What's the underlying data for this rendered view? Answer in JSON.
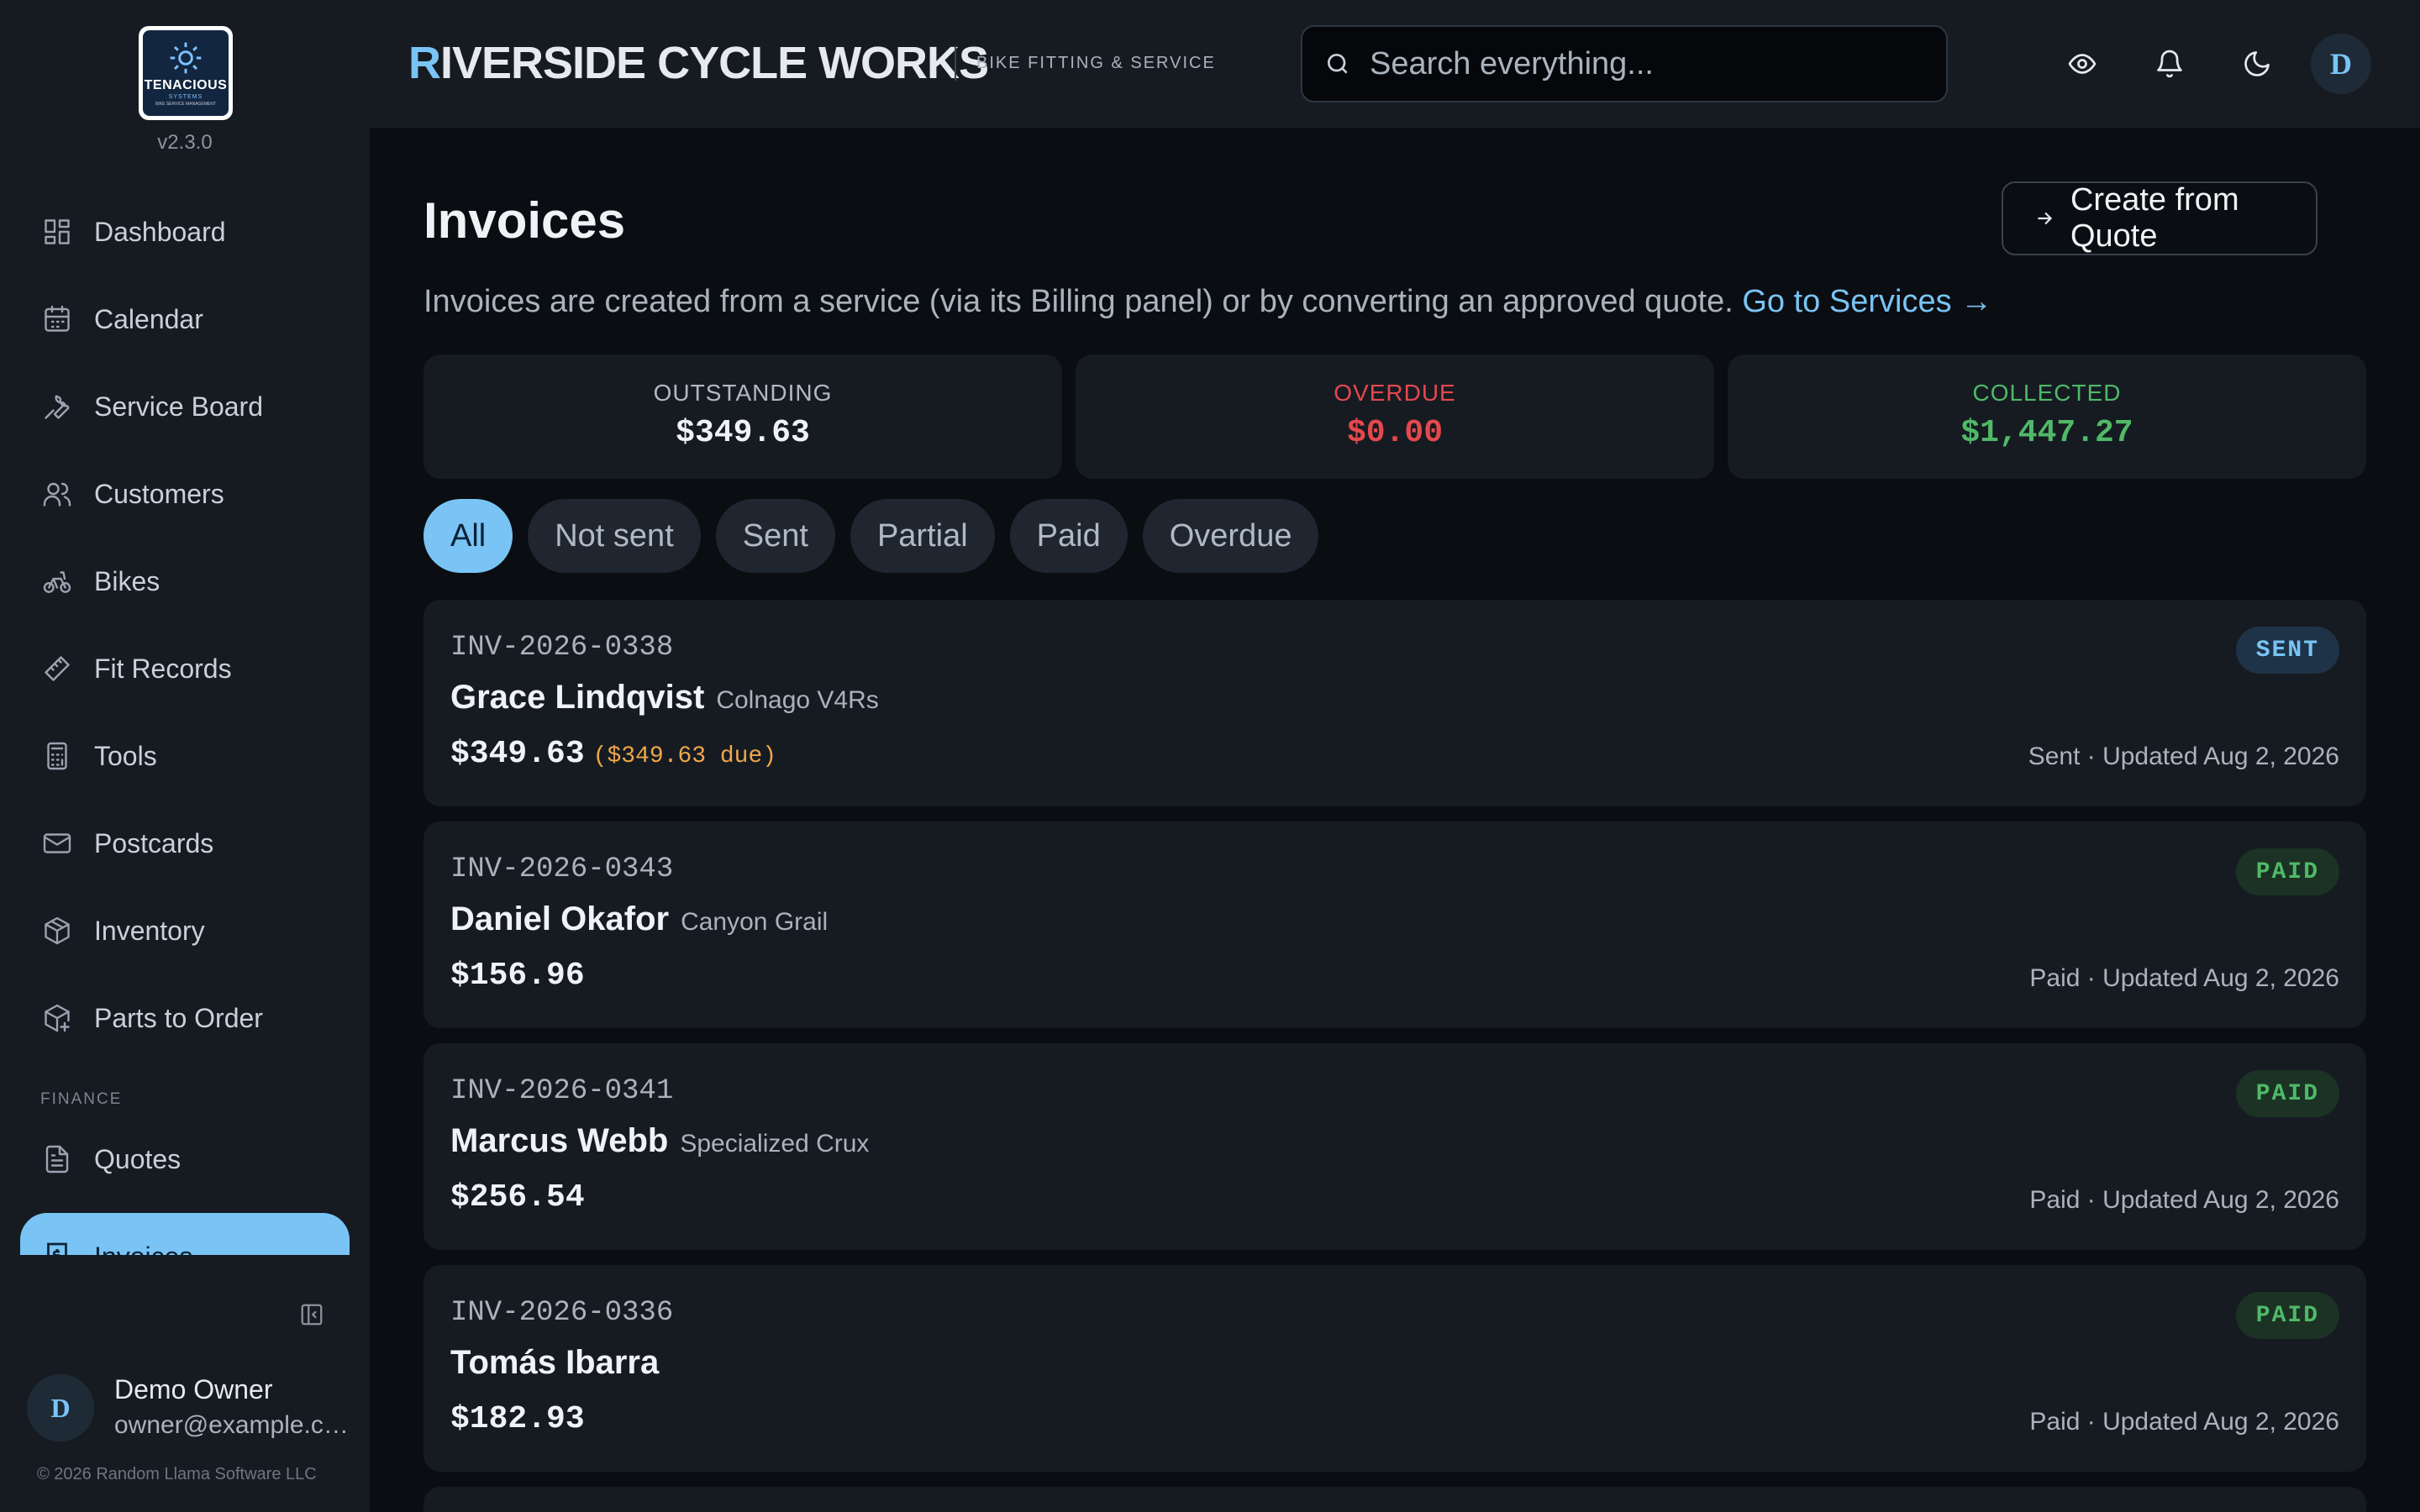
{
  "sidebar": {
    "logo": {
      "name": "TENACIOUS",
      "sub": "SYSTEMS",
      "tagline": "BIKE SERVICE MANAGEMENT"
    },
    "version": "v2.3.0",
    "items": [
      {
        "label": "Dashboard",
        "icon": "dashboard-icon"
      },
      {
        "label": "Calendar",
        "icon": "calendar-icon"
      },
      {
        "label": "Service Board",
        "icon": "wrench-icon"
      },
      {
        "label": "Customers",
        "icon": "users-icon"
      },
      {
        "label": "Bikes",
        "icon": "bike-icon"
      },
      {
        "label": "Fit Records",
        "icon": "ruler-icon"
      },
      {
        "label": "Tools",
        "icon": "calculator-icon"
      },
      {
        "label": "Postcards",
        "icon": "mail-icon"
      },
      {
        "label": "Inventory",
        "icon": "box-icon"
      },
      {
        "label": "Parts to Order",
        "icon": "package-plus-icon"
      }
    ],
    "section_finance": "FINANCE",
    "finance_items": [
      {
        "label": "Quotes",
        "icon": "document-icon"
      },
      {
        "label": "Invoices",
        "icon": "invoice-icon",
        "active": true
      }
    ],
    "user": {
      "initial": "D",
      "name": "Demo Owner",
      "email": "owner@example.com"
    },
    "copyright": "© 2026 Random Llama Software LLC"
  },
  "header": {
    "brand_first": "R",
    "brand_rest": "IVERSIDE CYCLE WORKS",
    "brand_sub": "BIKE FITTING & SERVICE",
    "search_placeholder": "Search everything...",
    "avatar_initial": "D"
  },
  "main": {
    "title": "Invoices",
    "create_button": "Create from Quote",
    "intro_text": "Invoices are created from a service (via its Billing panel) or by converting an approved quote.",
    "intro_link": "Go to Services →",
    "stats": [
      {
        "label": "OUTSTANDING",
        "value": "$349.63",
        "color": "#e6e9ee",
        "label_color": "#b1bac4"
      },
      {
        "label": "OVERDUE",
        "value": "$0.00",
        "color": "#e5484d",
        "label_color": "#e5484d"
      },
      {
        "label": "COLLECTED",
        "value": "$1,447.27",
        "color": "#4fb968",
        "label_color": "#4fb968"
      }
    ],
    "filters": [
      "All",
      "Not sent",
      "Sent",
      "Partial",
      "Paid",
      "Overdue"
    ],
    "active_filter": "All",
    "invoices": [
      {
        "number": "INV-2026-0338",
        "customer": "Grace Lindqvist",
        "bike": "Colnago V4Rs",
        "amount": "$349.63",
        "due": "($349.63 due)",
        "status": "SENT",
        "meta": "Sent · Updated Aug 2, 2026"
      },
      {
        "number": "INV-2026-0343",
        "customer": "Daniel Okafor",
        "bike": "Canyon Grail",
        "amount": "$156.96",
        "due": "",
        "status": "PAID",
        "meta": "Paid · Updated Aug 2, 2026"
      },
      {
        "number": "INV-2026-0341",
        "customer": "Marcus Webb",
        "bike": "Specialized Crux",
        "amount": "$256.54",
        "due": "",
        "status": "PAID",
        "meta": "Paid · Updated Aug 2, 2026"
      },
      {
        "number": "INV-2026-0336",
        "customer": "Tomás Ibarra",
        "bike": "",
        "amount": "$182.93",
        "due": "",
        "status": "PAID",
        "meta": "Paid · Updated Aug 2, 2026"
      }
    ]
  },
  "colors": {
    "accent": "#79c4f5",
    "bg": "#0a0d11",
    "panel": "#161b22",
    "paid": "#4fb968",
    "overdue": "#e5484d",
    "due": "#f0a64a"
  }
}
